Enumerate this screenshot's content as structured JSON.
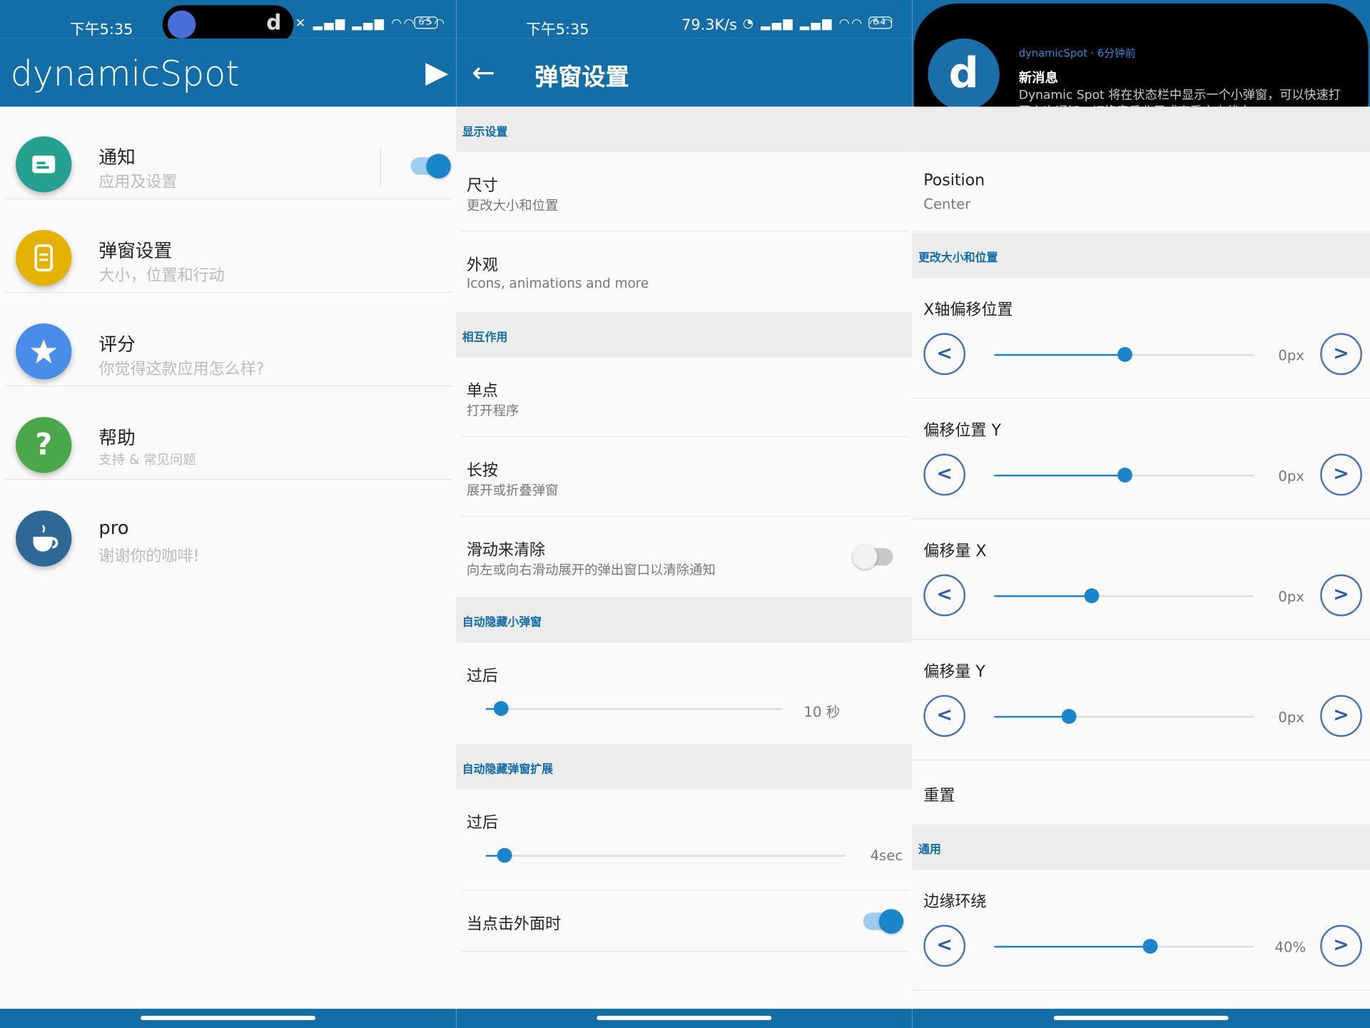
{
  "panel1": {
    "status": {
      "time": "下午5:35",
      "battery": "65",
      "island_glyph": "d"
    },
    "app_title": "dynamicSpot",
    "items": [
      {
        "title": "通知",
        "subtitle": "应用及设置",
        "icon": "message-icon",
        "color": "#26a08f"
      },
      {
        "title": "弹窗设置",
        "subtitle": "大小，位置和行动",
        "icon": "phone-icon",
        "color": "#e5b100"
      },
      {
        "title": "评分",
        "subtitle": "你觉得这款应用怎么样?",
        "icon": "star-icon",
        "color": "#4a8de8"
      },
      {
        "title": "帮助",
        "subtitle": "支持 & 常见问题",
        "icon": "question-icon",
        "color": "#4aa84a"
      },
      {
        "title": "pro",
        "subtitle": "谢谢你的咖啡!",
        "icon": "coffee-icon",
        "color": "#2e6894"
      }
    ],
    "notification_switch_on": true
  },
  "panel2": {
    "status": {
      "time": "下午5:35",
      "speed": "79.3K/s",
      "battery": "64"
    },
    "title": "弹窗设置",
    "sections": {
      "display": "显示设置",
      "interaction": "相互作用",
      "autohide_small": "自动隐藏小弹窗",
      "autohide_expanded": "自动隐藏弹窗扩展"
    },
    "size": {
      "title": "尺寸",
      "subtitle": "更改大小和位置"
    },
    "appearance": {
      "title": "外观",
      "subtitle": "Icons, animations and more"
    },
    "single_tap": {
      "title": "单点",
      "subtitle": "打开程序"
    },
    "long_press": {
      "title": "长按",
      "subtitle": "展开或折叠弹窗"
    },
    "swipe_clear": {
      "title": "滑动来清除",
      "subtitle": "向左或向右滑动展开的弹出窗口以清除通知",
      "on": false
    },
    "after1": {
      "title": "过后",
      "value": "10 秒",
      "fraction": 0.05
    },
    "after2": {
      "title": "过后",
      "value": "4sec",
      "fraction": 0.05
    },
    "outside_tap": {
      "title": "当点击外面时",
      "on": true
    }
  },
  "panel3": {
    "notification": {
      "app": "dynamicSpot",
      "time": "6分钟前",
      "title": "新消息",
      "body": "Dynamic Spot 将在状态栏中显示一个小弹窗，可以快速打开上次通知、切换音乐曲目或查看充电状态。",
      "logo_glyph": "d"
    },
    "position": {
      "title": "Position",
      "value": "Center"
    },
    "section_size": "更改大小和位置",
    "sliders": [
      {
        "title": "X轴偏移位置",
        "value": "0px",
        "fraction": 0.5
      },
      {
        "title": "偏移位置 Y",
        "value": "0px",
        "fraction": 0.5
      },
      {
        "title": "偏移量 X",
        "value": "0px",
        "fraction": 0.375
      },
      {
        "title": "偏移量 Y",
        "value": "0px",
        "fraction": 0.285
      }
    ],
    "reset": "重置",
    "section_general": "通用",
    "edge": {
      "title": "边缘环绕",
      "value": "40%",
      "fraction": 0.6
    },
    "left_glyph": "<",
    "right_glyph": ">"
  },
  "colors": {
    "primary": "#136ea7",
    "accent": "#1a85c8"
  }
}
